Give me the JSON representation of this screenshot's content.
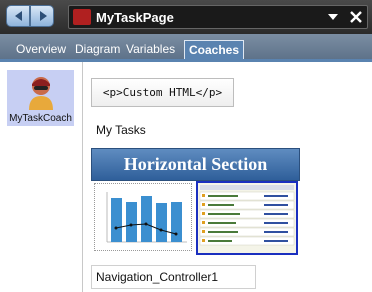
{
  "window": {
    "title": "MyTaskPage"
  },
  "tabs": [
    "Overview",
    "Diagram",
    "Variables"
  ],
  "active_tab": "Coaches",
  "coaches": [
    {
      "label": "MyTaskCoach"
    }
  ],
  "canvas": {
    "custom_html": "<p>Custom HTML</p>",
    "heading_text": "My Tasks",
    "section_title": "Horizontal Section",
    "nav_controller": "Navigation_Controller1"
  },
  "colors": {
    "accent": "#5a83b0",
    "selection": "#c7cff3",
    "section": "#3b6aa6"
  }
}
